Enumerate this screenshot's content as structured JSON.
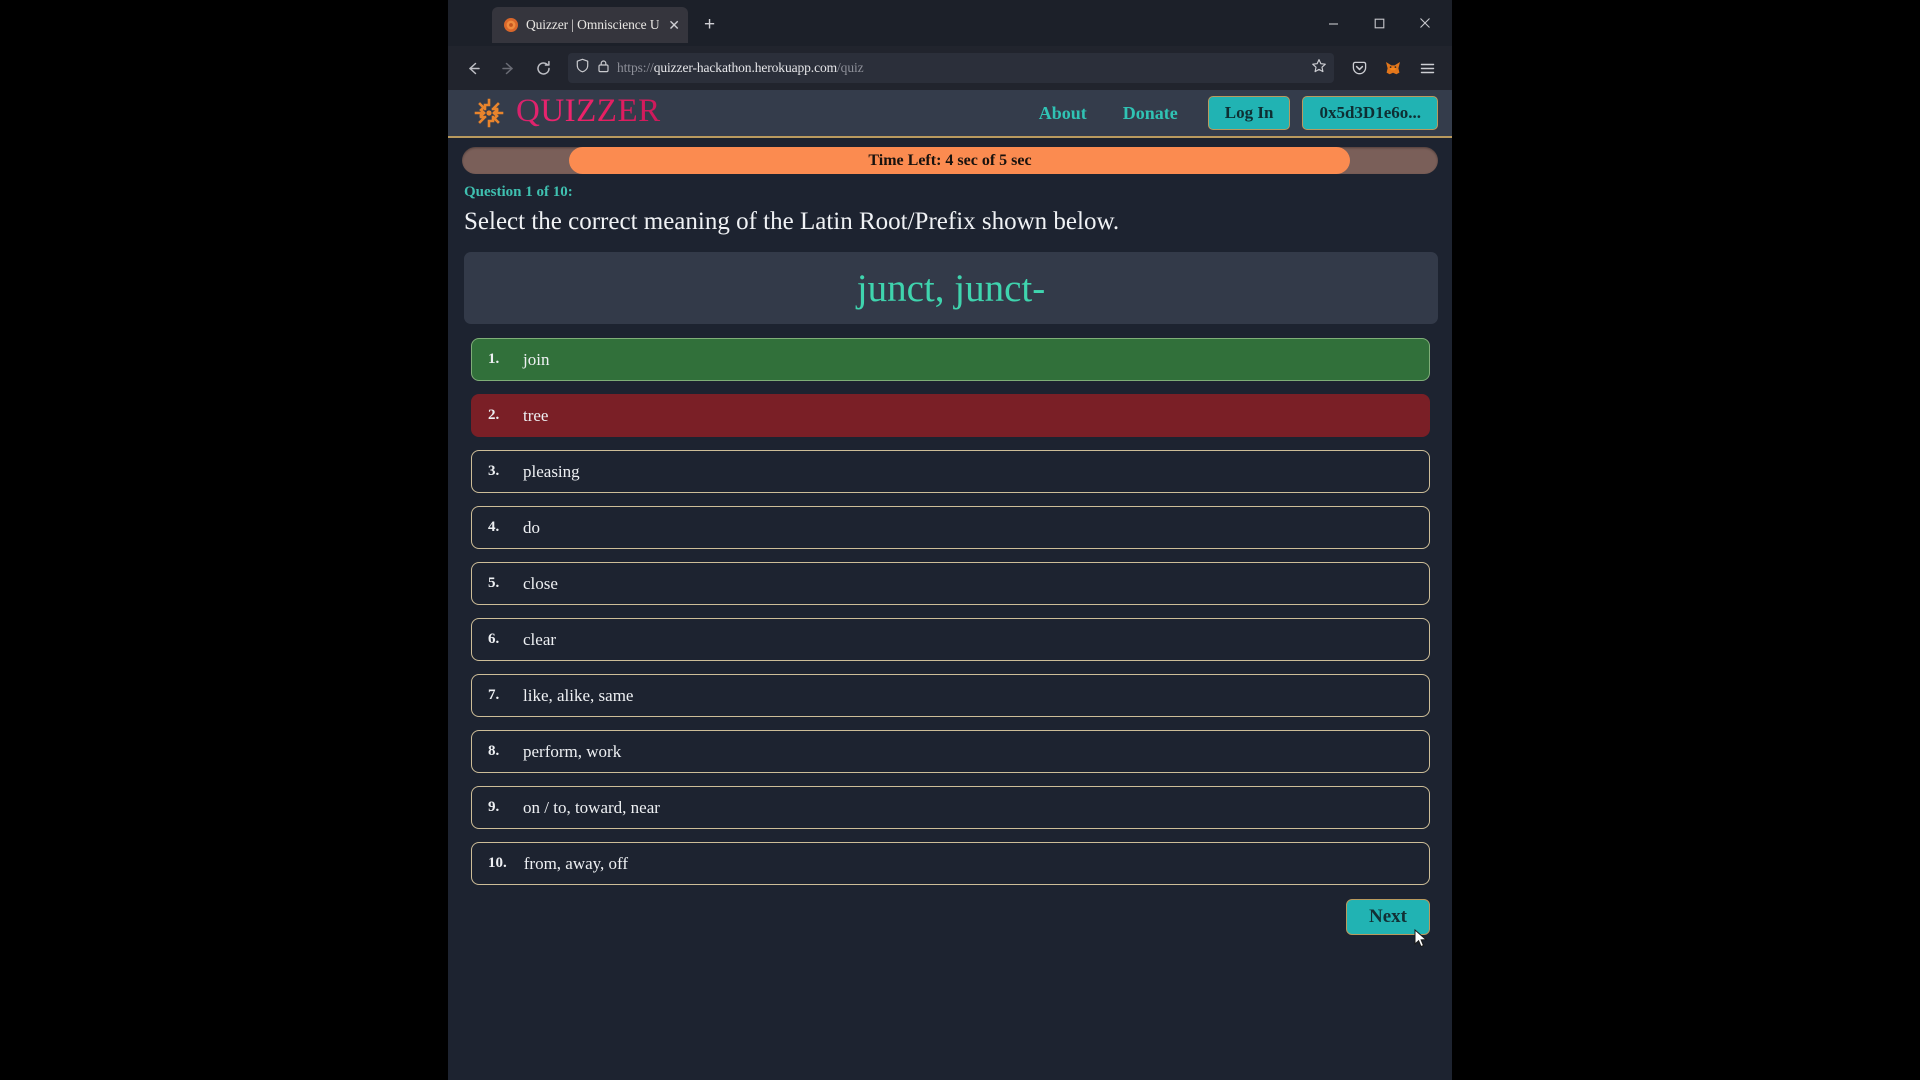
{
  "browser": {
    "tab": {
      "title": "Quizzer | Omniscience Unlocked",
      "favicon_name": "quizzer-pinwheel-favicon",
      "close_label": "✕"
    },
    "new_tab_label": "+",
    "window_controls": {
      "minimize": "–",
      "maximize": "❐",
      "close": "✕"
    },
    "nav": {
      "back": "←",
      "forward": "→",
      "reload": "↻"
    },
    "url": {
      "full": "https://quizzer-hackathon.herokuapp.com/quiz",
      "scheme": "https://",
      "host": "quizzer-hackathon.herokuapp.com",
      "path": "/quiz",
      "shield_icon": "tracking-protection-shield",
      "lock_icon": "padlock-secure",
      "bookmark_icon": "star-outline"
    },
    "toolbar_icons": [
      "pocket-save-icon",
      "metamask-fox-icon",
      "hamburger-menu-icon"
    ]
  },
  "site": {
    "brand": {
      "name": "QUIZZER",
      "logo_name": "pinwheel-logo"
    },
    "nav": {
      "links": [
        {
          "label": "About",
          "name": "nav-link-about"
        },
        {
          "label": "Donate",
          "name": "nav-link-donate"
        }
      ],
      "login_label": "Log In",
      "wallet_label": "0x5d3D1e6o..."
    },
    "colors": {
      "accent_teal": "#21b3b3",
      "brand_pink": "#e61f62",
      "border_gold": "#b99a5e",
      "timer_orange": "#fb8b50",
      "correct_green": "#31703a",
      "wrong_red": "#7a1f26",
      "page_bg": "#1d2330"
    }
  },
  "quiz": {
    "timer": {
      "label": "Time Left: 4 sec of 5 sec",
      "remaining_sec": 4,
      "total_sec": 5,
      "percent": 80
    },
    "question_meta": "Question 1 of 10:",
    "question_number": 1,
    "question_total": 10,
    "question_title": "Select the correct meaning of the Latin Root/Prefix shown below.",
    "prompt": "junct, junct-",
    "options": [
      {
        "num": "1.",
        "text": "join",
        "state": "correct"
      },
      {
        "num": "2.",
        "text": "tree",
        "state": "wrong"
      },
      {
        "num": "3.",
        "text": "pleasing",
        "state": "default"
      },
      {
        "num": "4.",
        "text": "do",
        "state": "default"
      },
      {
        "num": "5.",
        "text": "close",
        "state": "default"
      },
      {
        "num": "6.",
        "text": "clear",
        "state": "default"
      },
      {
        "num": "7.",
        "text": "like, alike, same",
        "state": "default"
      },
      {
        "num": "8.",
        "text": "perform, work",
        "state": "default"
      },
      {
        "num": "9.",
        "text": "on / to, toward, near",
        "state": "default"
      },
      {
        "num": "10.",
        "text": "from, away, off",
        "state": "default"
      }
    ],
    "next_label": "Next"
  }
}
